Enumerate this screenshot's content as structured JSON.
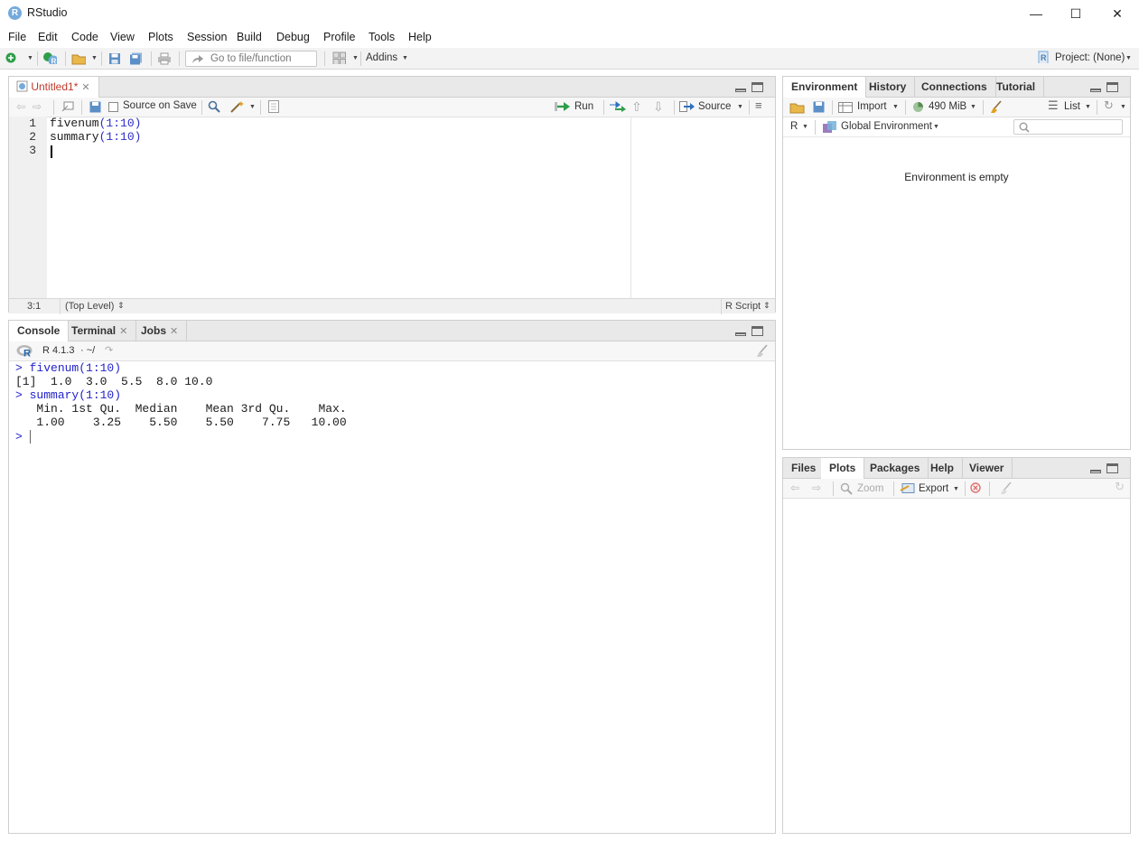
{
  "window": {
    "title": "RStudio",
    "logo_letter": "R",
    "minimize": "—",
    "maximize": "☐",
    "close": "✕"
  },
  "menu": [
    "File",
    "Edit",
    "Code",
    "View",
    "Plots",
    "Session",
    "Build",
    "Debug",
    "Profile",
    "Tools",
    "Help"
  ],
  "toolbar": {
    "goto_placeholder": "Go to file/function",
    "addins": "Addins",
    "project": "Project: (None)"
  },
  "source_pane": {
    "tab_label": "Untitled1*",
    "source_on_save": "Source on Save",
    "run": "Run",
    "source": "Source",
    "lines": [
      {
        "num": "1",
        "fn": "fivenum",
        "arg": "(1:10)"
      },
      {
        "num": "2",
        "fn": "summary",
        "arg": "(1:10)"
      },
      {
        "num": "3",
        "fn": "",
        "arg": ""
      }
    ],
    "status_pos": "3:1",
    "status_scope": "(Top Level)",
    "status_type": "R Script"
  },
  "console_pane": {
    "tabs": [
      "Console",
      "Terminal",
      "Jobs"
    ],
    "version": "R 4.1.3",
    "path": "· ~/",
    "output": [
      {
        "prompt": "> ",
        "text": "fivenum(1:10)",
        "kind": "cmd"
      },
      {
        "prompt": "",
        "text": "[1]  1.0  3.0  5.5  8.0 10.0",
        "kind": "out"
      },
      {
        "prompt": "> ",
        "text": "summary(1:10)",
        "kind": "cmd"
      },
      {
        "prompt": "",
        "text": "   Min. 1st Qu.  Median    Mean 3rd Qu.    Max. ",
        "kind": "out"
      },
      {
        "prompt": "",
        "text": "   1.00    3.25    5.50    5.50    7.75   10.00 ",
        "kind": "out"
      },
      {
        "prompt": "> ",
        "text": "",
        "kind": "cmd"
      }
    ]
  },
  "env_pane": {
    "tabs": [
      "Environment",
      "History",
      "Connections",
      "Tutorial"
    ],
    "import": "Import",
    "memory": "490 MiB",
    "list": "List",
    "lang": "R",
    "scope": "Global Environment",
    "empty_msg": "Environment is empty"
  },
  "files_pane": {
    "tabs": [
      "Files",
      "Plots",
      "Packages",
      "Help",
      "Viewer"
    ],
    "zoom": "Zoom",
    "export": "Export"
  },
  "colors": {
    "accent": "#75aadb",
    "code_number": "#2d2dc8",
    "console_cmd": "#2222cc",
    "tab_unsaved": "#c0392b"
  }
}
